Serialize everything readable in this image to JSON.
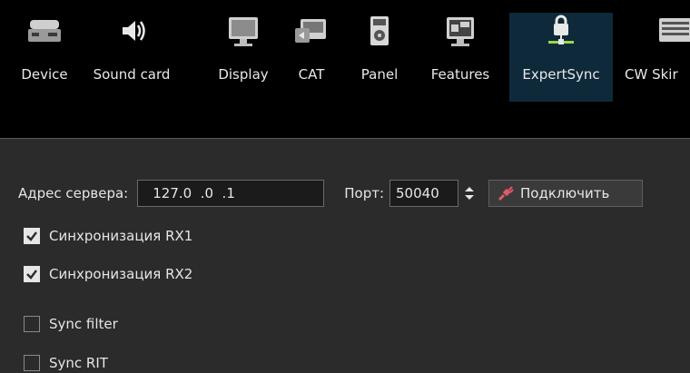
{
  "toolbar": {
    "items": [
      {
        "label": "Device",
        "icon": "device-icon",
        "active": false
      },
      {
        "label": "Sound card",
        "icon": "speaker-icon",
        "active": false
      },
      {
        "label": "Display",
        "icon": "monitor-icon",
        "active": false
      },
      {
        "label": "CAT",
        "icon": "cat-icon",
        "active": false
      },
      {
        "label": "Panel",
        "icon": "panel-icon",
        "active": false
      },
      {
        "label": "Features",
        "icon": "features-icon",
        "active": false
      },
      {
        "label": "ExpertSync",
        "icon": "network-lock-icon",
        "active": true
      },
      {
        "label": "CW Skir",
        "icon": "keyboard-icon",
        "active": false
      }
    ]
  },
  "server": {
    "address_label": "Адрес сервера:",
    "address_value": "127.0  .0  .1",
    "port_label": "Порт:",
    "port_value": "50040",
    "connect_label": "Подключить"
  },
  "options": [
    {
      "label": "Синхронизация RX1",
      "checked": true
    },
    {
      "label": "Синхронизация RX2",
      "checked": true
    },
    {
      "label": "Sync filter",
      "checked": false
    },
    {
      "label": "Sync RIT",
      "checked": false
    }
  ],
  "colors": {
    "toolbar_bg": "#000000",
    "active_tab_bg": "#0e2a3a",
    "panel_bg": "#2b2b2b",
    "field_bg": "#1b1b1b",
    "text": "#e6e6e6"
  }
}
